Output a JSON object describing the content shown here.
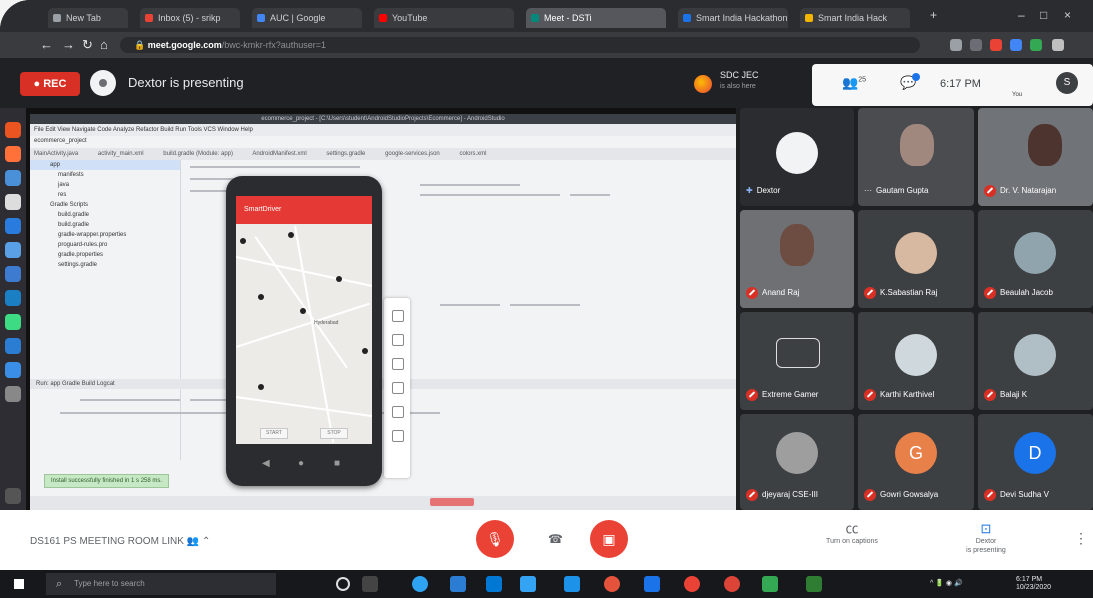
{
  "browser": {
    "tabs": [
      {
        "label": "New Tab",
        "color": "#9aa0a6"
      },
      {
        "label": "Inbox (5) - srikp",
        "color": "#ea4335"
      },
      {
        "label": "AUC | Google",
        "color": "#4285f4"
      },
      {
        "label": "YouTube",
        "color": "#ff0000"
      },
      {
        "label": "Meet - DSTi",
        "color": "#00897b",
        "active": true
      },
      {
        "label": "Smart India Hackathon",
        "color": "#1a73e8"
      },
      {
        "label": "Smart India Hack",
        "color": "#f4b400"
      }
    ],
    "url_host": "meet.google.com",
    "url_path": "/bwc-kmkr-rfx?authuser=1"
  },
  "meet": {
    "rec_label": "REC",
    "presenter_text": "Dextor is presenting",
    "org_name": "SDC JEC",
    "org_sub": "is also here",
    "count": "25",
    "time": "6:17 PM",
    "you_label": "You",
    "self_initial": "S",
    "meeting_title": "DS161 PS MEETING ROOM LINK",
    "captions_label": "Turn on captions",
    "presenting_label_1": "Dextor",
    "presenting_label_2": "is presenting"
  },
  "ide": {
    "title": "ecommerce_project - [C:\\Users\\student\\AndroidStudioProjects\\Ecommerce] - AndroidStudio",
    "menu": "File  Edit  View  Navigate  Code  Analyze  Refactor  Build  Run  Tools  VCS  Window  Help",
    "project_label": "ecommerce_project",
    "tabs": [
      "MainActivity.java",
      "activity_main.xml",
      "build.gradle (Module: app)",
      "AndroidManifest.xml",
      "settings.gradle",
      "google-services.json",
      "colors.xml"
    ],
    "tree": [
      "app",
      "manifests",
      "java",
      "res",
      "Gradle Scripts",
      "build.gradle",
      "build.gradle",
      "gradle-wrapper.properties",
      "proguard-rules.pro",
      "gradle.properties",
      "settings.gradle"
    ],
    "run_panel": "Run: app  Gradle Build  Logcat",
    "status_msg": "Install successfully finished in 1 s 258 ms."
  },
  "app": {
    "title": "SmartDriver",
    "map_label": "Hyderabad",
    "btn_left": "START",
    "btn_right": "STOP"
  },
  "participants": [
    {
      "name": "Dextor",
      "type": "avatar",
      "presenting": true
    },
    {
      "name": "Gautam Gupta",
      "type": "video"
    },
    {
      "name": "Dr. V. Natarajan",
      "type": "video",
      "muted": true
    },
    {
      "name": "Anand Raj",
      "type": "video",
      "muted": true
    },
    {
      "name": "K.Sabastian Raj",
      "type": "photo",
      "muted": true
    },
    {
      "name": "Beaulah Jacob",
      "type": "photo",
      "muted": true
    },
    {
      "name": "Extreme Gamer",
      "type": "logo",
      "muted": true
    },
    {
      "name": "Karthi Karthivel",
      "type": "photo",
      "muted": true
    },
    {
      "name": "Balaji K",
      "type": "photo",
      "muted": true
    },
    {
      "name": "djeyaraj CSE-III",
      "type": "photo",
      "muted": true
    },
    {
      "name": "Gowri Gowsalya",
      "type": "initial",
      "initial": "G",
      "color": "#e8804a",
      "muted": true
    },
    {
      "name": "Devi Sudha V",
      "type": "initial",
      "initial": "D",
      "color": "#1a73e8",
      "muted": true
    }
  ],
  "taskbar": {
    "search_placeholder": "Type here to search",
    "time": "6:17 PM",
    "date": "10/23/2020"
  },
  "colors": {
    "rec": "#d93025",
    "accent": "#1a73e8",
    "end_call": "#ea4335"
  }
}
